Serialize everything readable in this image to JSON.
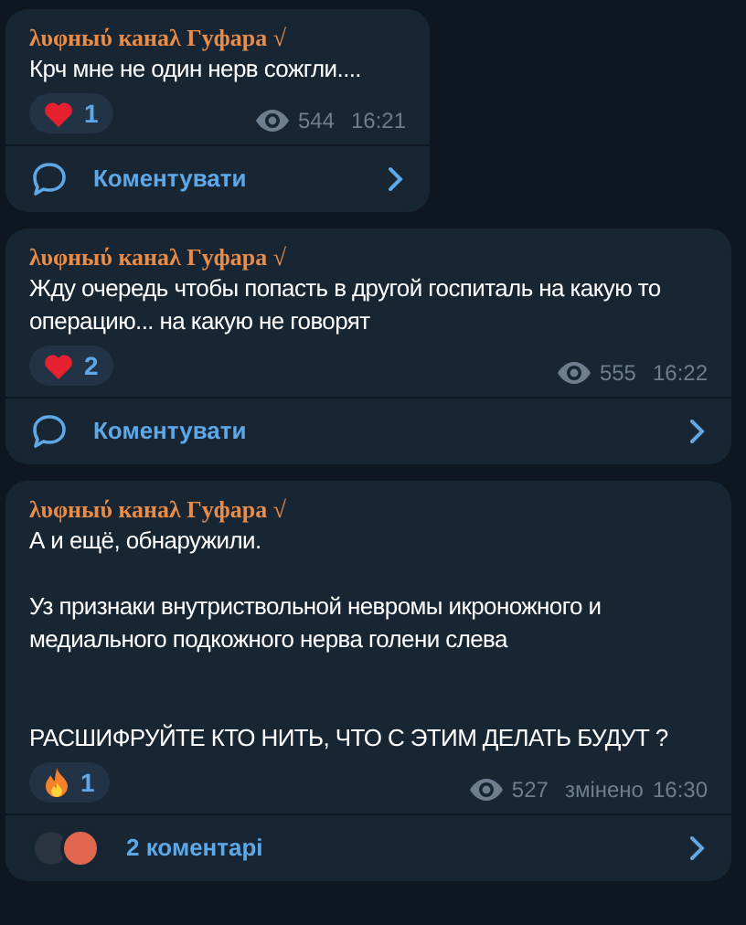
{
  "messages": [
    {
      "author": "λυφныύ канаλ Γyфаpа √",
      "text": "Крч мне не один нерв сожгли....",
      "reaction": {
        "kind": "heart",
        "count": "1"
      },
      "views": "544",
      "time": "16:21",
      "footer": {
        "kind": "comment",
        "label": "Коментувати"
      }
    },
    {
      "author": "λυφныύ канаλ Γyфаpа √",
      "text": "Жду очередь чтобы попасть в другой госпиталь на какую то операцию... на какую не говорят",
      "reaction": {
        "kind": "heart",
        "count": "2"
      },
      "views": "555",
      "time": "16:22",
      "footer": {
        "kind": "comment",
        "label": "Коментувати"
      }
    },
    {
      "author": "λυφныύ канаλ Γyфаpа √",
      "text": "А и ещё, обнаружили.\n\nУз признаки внутриствольной невромы икроножного и медиального подкожного нерва голени слева\n\n\nРАСШИФРУЙТЕ КТО НИТЬ, ЧТО С ЭТИМ ДЕЛАТЬ БУДУТ ?",
      "reaction": {
        "kind": "fire",
        "count": "1"
      },
      "views": "527",
      "edited": "змінено",
      "time": "16:30",
      "footer": {
        "kind": "avatars",
        "label": "2 коментарі"
      }
    }
  ]
}
